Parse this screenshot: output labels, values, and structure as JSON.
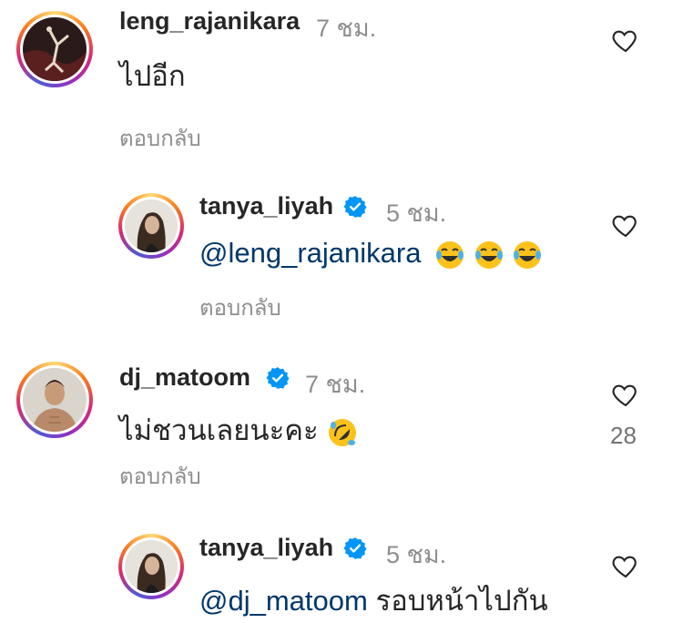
{
  "comments": [
    {
      "username": "leng_rajanikara",
      "verified": false,
      "time": "7 ชม.",
      "text": "ไปอีก",
      "reply_label": "ตอบกลับ"
    },
    {
      "username": "tanya_liyah",
      "verified": true,
      "time": "5 ชม.",
      "mention": "@leng_rajanikara",
      "emoji_count": 3,
      "reply_label": "ตอบกลับ"
    },
    {
      "username": "dj_matoom",
      "verified": true,
      "time": "7 ชม.",
      "text": "ไม่ชวนเลยนะคะ",
      "emoji_count": 1,
      "likes": "28",
      "reply_label": "ตอบกลับ"
    },
    {
      "username": "tanya_liyah",
      "verified": true,
      "time": "5 ชม.",
      "mention": "@dj_matoom",
      "text": " รอบหน้าไปกัน"
    }
  ],
  "colors": {
    "verified_blue": "#0095f6",
    "mention_blue": "#00376b",
    "muted_gray": "#8e8e8e"
  },
  "icons": {
    "like": "heart-icon",
    "verified": "verified-badge-icon",
    "laughing": "tears-of-joy-emoji",
    "rofl": "rolling-on-floor-laughing-emoji"
  }
}
